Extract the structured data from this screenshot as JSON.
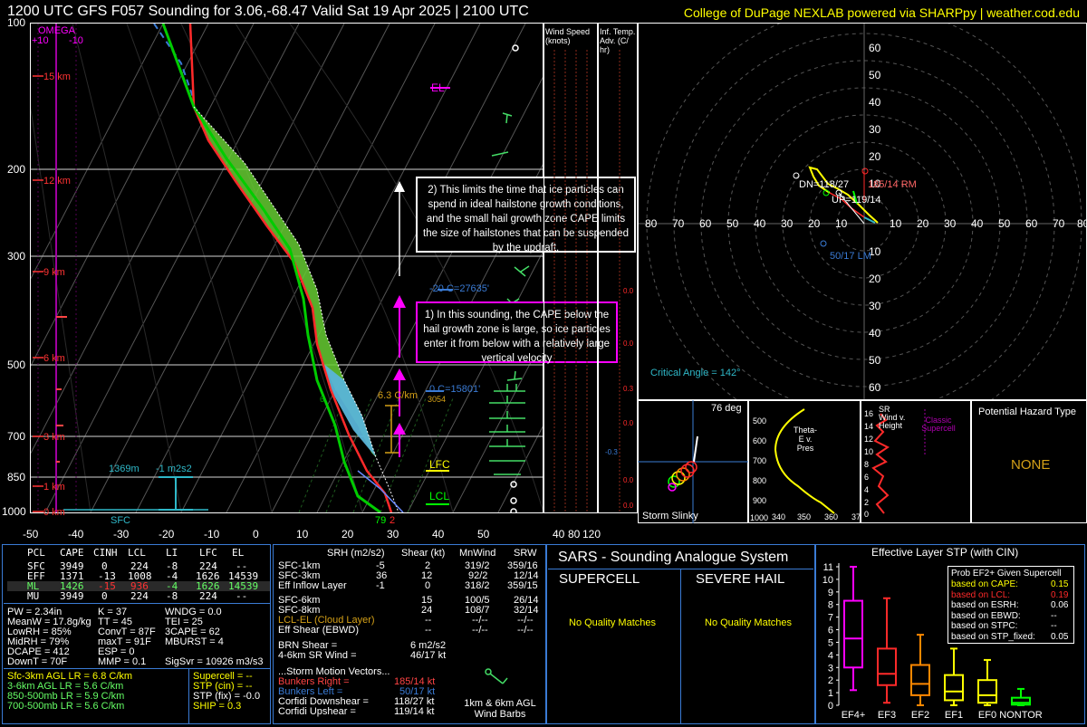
{
  "header": {
    "title": "1200 UTC GFS F057 Sounding for 3.06,-68.47 Valid  Sat 19 Apr 2025 | 2100 UTC",
    "credit": "College of DuPage NEXLAB powered via SHARPpy | weather.cod.edu"
  },
  "colors": {
    "bg": "#000000",
    "panel_border": "#3a7bd5",
    "yellow": "#ffff00",
    "magenta": "#ff00ff",
    "cyan": "#00ccff",
    "red": "#ff2a2a",
    "green": "#00ff00",
    "orange": "#ff8800"
  },
  "skewt": {
    "pressure_ticks": [
      "100",
      "200",
      "300",
      "500",
      "700",
      "850",
      "1000"
    ],
    "temp_ticks": [
      "-50",
      "-40",
      "-30",
      "-20",
      "-10",
      "0",
      "10",
      "20",
      "30",
      "40",
      "50"
    ],
    "omega_label": "OMEGA",
    "omega_plus": "+10",
    "omega_minus": "-10",
    "height_labels": [
      "15 km",
      "12 km",
      "9 km",
      "6 km",
      "3 km",
      "1 km",
      "0 km"
    ],
    "el_label": "EL",
    "lfc_label": "LFC",
    "lcl_label": "LCL",
    "sfc_label": "SFC",
    "srh_depth_label": "1369m",
    "srh_value_label": "-1 m2s2",
    "lapse_label": "6.3 C/km",
    "m20c_label": "-20 C=27635'",
    "zero_c_label": "0 C=15801'",
    "sfc_temp": "79",
    "sfc_dew": "2",
    "small_left": "6",
    "small_right": "3054"
  },
  "annotations": {
    "box2": "2) This limits the time that ice particles can spend in ideal hailstone growth conditions, and the small hail growth zone CAPE limits the size of hailstones that can be suspended by the updraft.",
    "box1": "1) In this sounding, the CAPE below the hail growth zone is large, so ice particles enter it from below with a relatively large vertical velocity"
  },
  "wind_speed": {
    "title": "Wind Speed (knots)",
    "ticks": [
      "40",
      "80",
      "120"
    ]
  },
  "inferred_temp": {
    "title": "Inf. Temp. Adv. (C/ hr)",
    "values": [
      "0.0",
      "0.0",
      "0.3",
      "0.0",
      "-0.3",
      "0.0",
      "0.0"
    ]
  },
  "hodograph": {
    "rings": [
      "10",
      "20",
      "30",
      "40",
      "50",
      "60"
    ],
    "x_ticks_left": [
      "80",
      "70",
      "60",
      "50",
      "40",
      "30",
      "20",
      "10"
    ],
    "x_ticks_right": [
      "10",
      "20",
      "30",
      "40",
      "50",
      "60",
      "70",
      "80"
    ],
    "y_ticks_top": [
      "60",
      "50",
      "40",
      "30",
      "20",
      "10"
    ],
    "y_ticks_bottom": [
      "10",
      "20",
      "30",
      "40",
      "50",
      "60"
    ],
    "dn_label": "DN=118/27",
    "up_label": "UP=119/14",
    "rm_label": "185/14 RM",
    "lm_label": "50/17 LM",
    "critical_angle": "Critical Angle = 142°"
  },
  "storm_slinky": {
    "title": "Storm Slinky",
    "deg": "76 deg"
  },
  "theta_e": {
    "title": "Theta-E v. Pres",
    "p_ticks": [
      "500",
      "600",
      "700",
      "800",
      "900",
      "1000"
    ],
    "t_ticks": [
      "340",
      "350",
      "360",
      "37"
    ]
  },
  "sr_wind": {
    "title": "SR Wind v. Height",
    "classic": "Classic Supercell",
    "h_ticks": [
      "16",
      "14",
      "12",
      "10",
      "8",
      "6",
      "4",
      "2",
      "0"
    ]
  },
  "hazard": {
    "title": "Potential Hazard Type",
    "value": "NONE"
  },
  "parcels": {
    "headers": [
      "PCL",
      "CAPE",
      "CINH",
      "LCL",
      "LI",
      "LFC",
      "EL"
    ],
    "rows": [
      [
        "SFC",
        "3949",
        "0",
        "224",
        "-8",
        "224",
        "--"
      ],
      [
        "EFF",
        "1371",
        "-13",
        "1008",
        "-4",
        "1626",
        "14539"
      ],
      [
        "ML",
        "1426",
        "-15",
        "936",
        "-4",
        "1626",
        "14539"
      ],
      [
        "MU",
        "3949",
        "0",
        "224",
        "-8",
        "224",
        "--"
      ]
    ]
  },
  "thermo": {
    "col1": [
      "PW = 2.34in",
      "MeanW = 17.8g/kg",
      "LowRH = 85%",
      "MidRH = 79%",
      "DCAPE = 412",
      "DownT = 70F"
    ],
    "col2": [
      "K = 37",
      "TT = 45",
      "ConvT = 87F",
      "maxT = 91F",
      "ESP = 0",
      "MMP = 0.1"
    ],
    "col3": [
      "WNDG = 0.0",
      "TEI = 25",
      "3CAPE = 62",
      "MBURST = 4",
      "",
      "SigSvr = 10926 m3/s3"
    ]
  },
  "lapse_rates": [
    "Sfc-3km AGL LR = 6.8 C/km",
    "3-6km AGL LR = 5.6 C/km",
    "850-500mb LR = 5.9 C/km",
    "700-500mb LR = 5.6 C/km"
  ],
  "severe_params": [
    "Supercell = --",
    "STP (cin) = --",
    "STP (fix) = -0.0",
    "SHIP = 0.3"
  ],
  "kinematics": {
    "headers": [
      "SRH (m2/s2)",
      "Shear (kt)",
      "MnWind",
      "SRW"
    ],
    "rows": [
      [
        "SFC-1km",
        "-5",
        "2",
        "319/2",
        "359/16"
      ],
      [
        "SFC-3km",
        "36",
        "12",
        "92/2",
        "12/14"
      ],
      [
        "Eff Inflow Layer",
        "-1",
        "0",
        "318/2",
        "359/15"
      ],
      [
        "SFC-6km",
        "",
        "15",
        "100/5",
        "26/14"
      ],
      [
        "SFC-8km",
        "",
        "24",
        "108/7",
        "32/14"
      ],
      [
        "LCL-EL (Cloud Layer)",
        "",
        "--",
        "--/--",
        "--/--"
      ],
      [
        "Eff Shear (EBWD)",
        "",
        "--",
        "--/--",
        "--/--"
      ]
    ],
    "brn_label": "BRN Shear =",
    "brn_value": "6 m2/s2",
    "srw46_label": "4-6km SR Wind =",
    "srw46_value": "46/17 kt",
    "storm_motion_title": "...Storm Motion Vectors...",
    "motions": [
      [
        "Bunkers Right =",
        "185/14 kt"
      ],
      [
        "Bunkers Left =",
        "50/17 kt"
      ],
      [
        "Corfidi Downshear =",
        "118/27 kt"
      ],
      [
        "Corfidi Upshear =",
        "119/14 kt"
      ]
    ],
    "barb_label": "1km & 6km AGL Wind Barbs"
  },
  "sars": {
    "title": "SARS - Sounding Analogue System",
    "supercell": "SUPERCELL",
    "severe_hail": "SEVERE HAIL",
    "no_match_left": "No Quality Matches",
    "no_match_right": "No Quality Matches"
  },
  "stp_box": {
    "title": "Effective Layer STP (with CIN)",
    "legend_title": "Prob EF2+ Given Supercell",
    "legend_rows": [
      [
        "based on CAPE:",
        "0.15"
      ],
      [
        "based on LCL:",
        "0.19"
      ],
      [
        "based on ESRH:",
        "0.06"
      ],
      [
        "based on EBWD:",
        "--"
      ],
      [
        "based on STPC:",
        "--"
      ],
      [
        "based on STP_fixed:",
        "0.05"
      ]
    ]
  },
  "chart_data": [
    {
      "type": "box",
      "title": "Effective Layer STP (with CIN)",
      "categories": [
        "EF4+",
        "EF3",
        "EF2",
        "EF1",
        "EF0",
        "NONTOR"
      ],
      "ylim": [
        0,
        11
      ],
      "y_ticks": [
        "0",
        "1",
        "2",
        "3",
        "4",
        "5",
        "6",
        "7",
        "8",
        "9",
        "10",
        "11"
      ],
      "boxes": [
        {
          "name": "EF4+",
          "whisker_low": 1.2,
          "q1": 3.0,
          "median": 5.3,
          "q3": 8.3,
          "whisker_high": 11.0,
          "color": "#ff00ff"
        },
        {
          "name": "EF3",
          "whisker_low": 0.2,
          "q1": 1.6,
          "median": 2.5,
          "q3": 4.5,
          "whisker_high": 8.5,
          "color": "#ff2a2a"
        },
        {
          "name": "EF2",
          "whisker_low": 0.0,
          "q1": 0.8,
          "median": 1.7,
          "q3": 3.2,
          "whisker_high": 5.6,
          "color": "#ff8800"
        },
        {
          "name": "EF1",
          "whisker_low": 0.0,
          "q1": 0.4,
          "median": 1.1,
          "q3": 2.4,
          "whisker_high": 4.5,
          "color": "#ffff00"
        },
        {
          "name": "EF0",
          "whisker_low": 0.0,
          "q1": 0.2,
          "median": 0.8,
          "q3": 2.0,
          "whisker_high": 3.6,
          "color": "#ffff00"
        },
        {
          "name": "NONTOR",
          "whisker_low": 0.0,
          "q1": 0.05,
          "median": 0.2,
          "q3": 0.6,
          "whisker_high": 1.3,
          "color": "#00ff00"
        }
      ]
    }
  ]
}
